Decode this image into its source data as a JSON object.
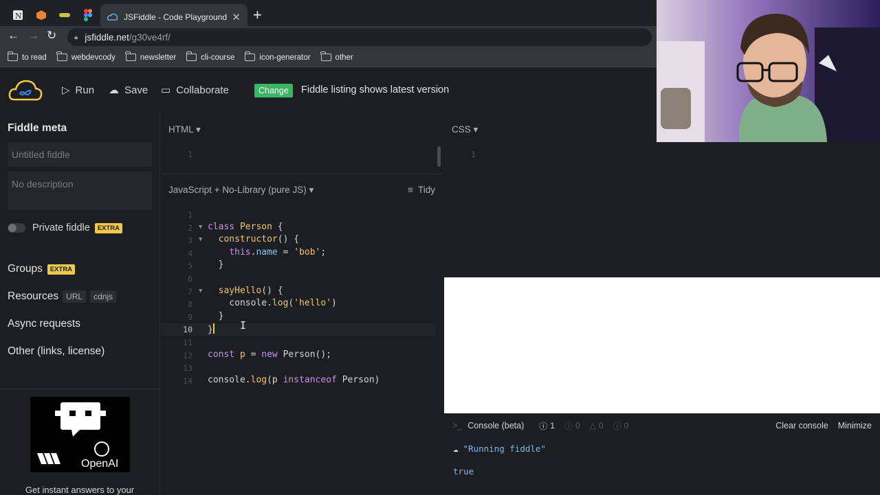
{
  "browser": {
    "active_tab_title": "JSFiddle - Code Playground",
    "url_host": "jsfiddle.net",
    "url_path": "/g30ve4rf/",
    "bookmarks": [
      "to read",
      "webdevcody",
      "newsletter",
      "cli-course",
      "icon-generator",
      "other"
    ]
  },
  "header": {
    "run_label": "Run",
    "save_label": "Save",
    "collaborate_label": "Collaborate",
    "change_label": "Change",
    "latest_text": "Fiddle listing shows latest version"
  },
  "sidebar": {
    "title": "Fiddle meta",
    "title_placeholder": "Untitled fiddle",
    "description_placeholder": "No description",
    "private_label": "Private fiddle",
    "extra_badge": "EXTRA",
    "groups_label": "Groups",
    "resources_label": "Resources",
    "resources_chips": [
      "URL",
      "cdnjs"
    ],
    "async_label": "Async requests",
    "other_label": "Other (links, license)",
    "ad_brand": "OpenAI",
    "ad_text": "Get instant answers to your"
  },
  "editors": {
    "html_label": "HTML",
    "css_label": "CSS",
    "js_label": "JavaScript + No-Library (pure JS)",
    "tidy_label": "Tidy",
    "html_line": "1",
    "css_line": "1"
  },
  "console": {
    "title": "Console (beta)",
    "error_count": "1",
    "warn_count": "0",
    "info_count": "0",
    "log_count": "0",
    "clear_label": "Clear console",
    "minimize_label": "Minimize",
    "line1": "\"Running fiddle\"",
    "line2": "true"
  },
  "colors": {
    "accent_green": "#3bb564",
    "extra_yellow": "#f0c94b",
    "editor_bg": "#1d1e22"
  }
}
